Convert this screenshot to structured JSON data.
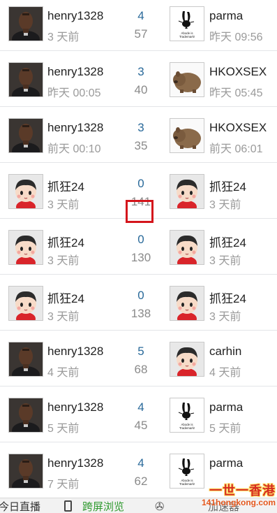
{
  "rows": [
    {
      "left_user": "henry1328",
      "left_time": "3 天前",
      "replies": "4",
      "views": "57",
      "right_user": "parma",
      "right_time": "昨天 09:56",
      "left_avatar": "man",
      "right_avatar": "bunny"
    },
    {
      "left_user": "henry1328",
      "left_time": "昨天 00:05",
      "replies": "3",
      "views": "40",
      "right_user": "HKOXSEX",
      "right_time": "昨天 05:45",
      "left_avatar": "man",
      "right_avatar": "wombat"
    },
    {
      "left_user": "henry1328",
      "left_time": "前天 00:10",
      "replies": "3",
      "views": "35",
      "right_user": "HKOXSEX",
      "right_time": "前天 06:01",
      "left_avatar": "man",
      "right_avatar": "wombat"
    },
    {
      "left_user": "抓狂24",
      "left_time": "3 天前",
      "replies": "0",
      "views": "141",
      "right_user": "抓狂24",
      "right_time": "3 天前",
      "left_avatar": "kid",
      "right_avatar": "kid"
    },
    {
      "left_user": "抓狂24",
      "left_time": "3 天前",
      "replies": "0",
      "views": "130",
      "right_user": "抓狂24",
      "right_time": "3 天前",
      "left_avatar": "kid",
      "right_avatar": "kid"
    },
    {
      "left_user": "抓狂24",
      "left_time": "3 天前",
      "replies": "0",
      "views": "138",
      "right_user": "抓狂24",
      "right_time": "3 天前",
      "left_avatar": "kid",
      "right_avatar": "kid"
    },
    {
      "left_user": "henry1328",
      "left_time": "4 天前",
      "replies": "5",
      "views": "68",
      "right_user": "carhin",
      "right_time": "4 天前",
      "left_avatar": "man",
      "right_avatar": "kid"
    },
    {
      "left_user": "henry1328",
      "left_time": "5 天前",
      "replies": "4",
      "views": "45",
      "right_user": "parma",
      "right_time": "5 天前",
      "left_avatar": "man",
      "right_avatar": "bunny"
    },
    {
      "left_user": "henry1328",
      "left_time": "7 天前",
      "replies": "4",
      "views": "62",
      "right_user": "parma",
      "right_time": "",
      "left_avatar": "man",
      "right_avatar": "bunny"
    }
  ],
  "bunny_caption": "Abode is Trademark!",
  "bottom_bar": {
    "today_label": "今日直播",
    "wide_label": "跨屏浏览",
    "more_label": "加速器"
  },
  "watermark": {
    "title": "一世一香港",
    "url": "141hongkong.com"
  },
  "highlight_color": "#d4151c"
}
